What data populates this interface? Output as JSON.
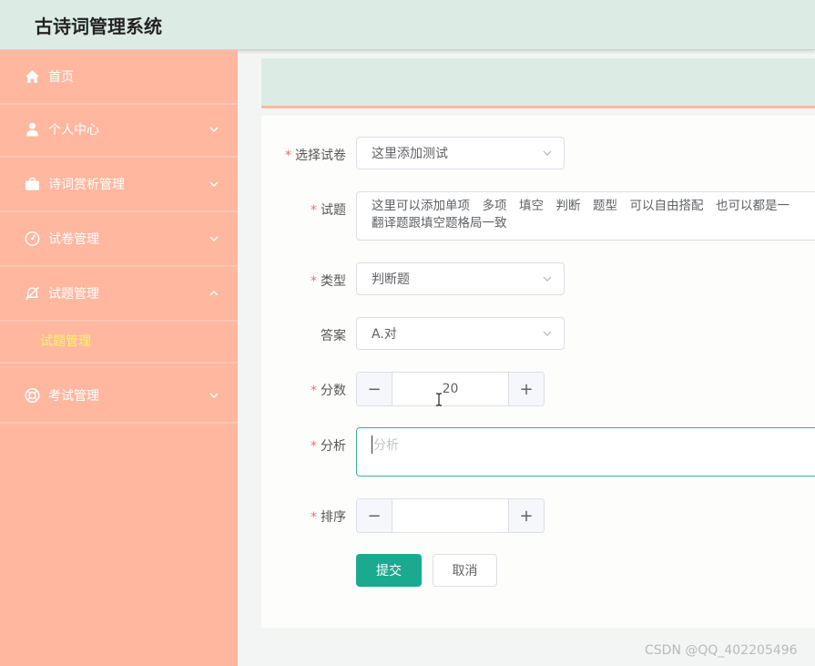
{
  "app": {
    "title": "古诗词管理系统"
  },
  "sidebar": {
    "items": [
      {
        "label": "首页",
        "icon": "home-icon"
      },
      {
        "label": "个人中心",
        "icon": "user-icon"
      },
      {
        "label": "诗词赏析管理",
        "icon": "briefcase-icon"
      },
      {
        "label": "试卷管理",
        "icon": "dashboard-icon"
      },
      {
        "label": "试题管理",
        "icon": "bell-off-icon"
      },
      {
        "label": "考试管理",
        "icon": "lifebuoy-icon"
      }
    ],
    "submenu": {
      "label": "试题管理"
    }
  },
  "form": {
    "paper": {
      "label": "选择试卷",
      "value": "这里添加测试"
    },
    "question": {
      "label": "试题",
      "value": "这里可以添加单项　多项　填空　判断　题型　可以自由搭配　也可以都是一\n翻译题跟填空题格局一致"
    },
    "type": {
      "label": "类型",
      "value": "判断题"
    },
    "answer": {
      "label": "答案",
      "value": "A.对"
    },
    "score": {
      "label": "分数",
      "value": "20",
      "minus": "−",
      "plus": "+"
    },
    "analysis": {
      "label": "分析",
      "placeholder": "分析"
    },
    "order": {
      "label": "排序",
      "value": "",
      "minus": "−",
      "plus": "+"
    },
    "submit_label": "提交",
    "cancel_label": "取消"
  },
  "watermark": "CSDN @QQ_402205496",
  "colors": {
    "sidebar": "#ffb79f",
    "topbar": "#dcece5",
    "primary": "#1aaa8f",
    "submenu_active": "#f8f36a",
    "required": "#f56c6c"
  }
}
